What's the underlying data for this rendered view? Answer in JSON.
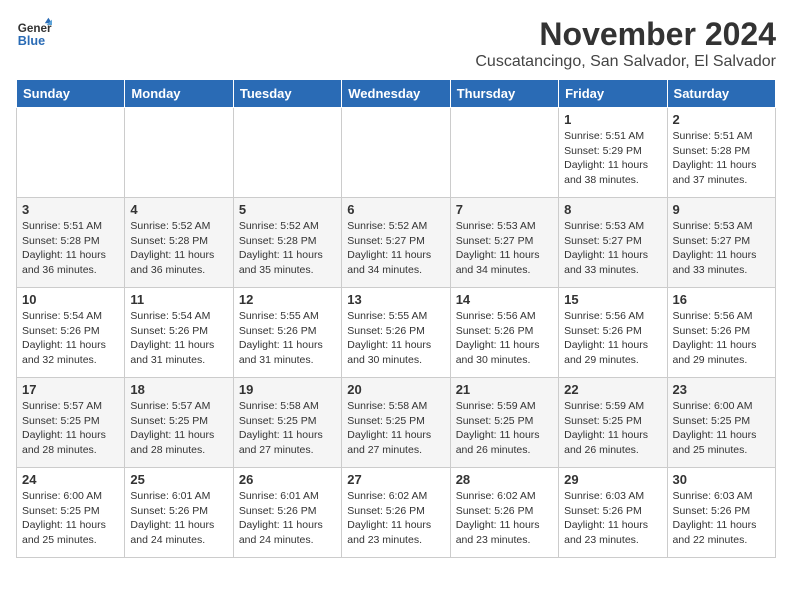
{
  "logo": {
    "line1": "General",
    "line2": "Blue"
  },
  "title": "November 2024",
  "location": "Cuscatancingo, San Salvador, El Salvador",
  "days_of_week": [
    "Sunday",
    "Monday",
    "Tuesday",
    "Wednesday",
    "Thursday",
    "Friday",
    "Saturday"
  ],
  "weeks": [
    [
      {
        "day": "",
        "content": ""
      },
      {
        "day": "",
        "content": ""
      },
      {
        "day": "",
        "content": ""
      },
      {
        "day": "",
        "content": ""
      },
      {
        "day": "",
        "content": ""
      },
      {
        "day": "1",
        "content": "Sunrise: 5:51 AM\nSunset: 5:29 PM\nDaylight: 11 hours\nand 38 minutes."
      },
      {
        "day": "2",
        "content": "Sunrise: 5:51 AM\nSunset: 5:28 PM\nDaylight: 11 hours\nand 37 minutes."
      }
    ],
    [
      {
        "day": "3",
        "content": "Sunrise: 5:51 AM\nSunset: 5:28 PM\nDaylight: 11 hours\nand 36 minutes."
      },
      {
        "day": "4",
        "content": "Sunrise: 5:52 AM\nSunset: 5:28 PM\nDaylight: 11 hours\nand 36 minutes."
      },
      {
        "day": "5",
        "content": "Sunrise: 5:52 AM\nSunset: 5:28 PM\nDaylight: 11 hours\nand 35 minutes."
      },
      {
        "day": "6",
        "content": "Sunrise: 5:52 AM\nSunset: 5:27 PM\nDaylight: 11 hours\nand 34 minutes."
      },
      {
        "day": "7",
        "content": "Sunrise: 5:53 AM\nSunset: 5:27 PM\nDaylight: 11 hours\nand 34 minutes."
      },
      {
        "day": "8",
        "content": "Sunrise: 5:53 AM\nSunset: 5:27 PM\nDaylight: 11 hours\nand 33 minutes."
      },
      {
        "day": "9",
        "content": "Sunrise: 5:53 AM\nSunset: 5:27 PM\nDaylight: 11 hours\nand 33 minutes."
      }
    ],
    [
      {
        "day": "10",
        "content": "Sunrise: 5:54 AM\nSunset: 5:26 PM\nDaylight: 11 hours\nand 32 minutes."
      },
      {
        "day": "11",
        "content": "Sunrise: 5:54 AM\nSunset: 5:26 PM\nDaylight: 11 hours\nand 31 minutes."
      },
      {
        "day": "12",
        "content": "Sunrise: 5:55 AM\nSunset: 5:26 PM\nDaylight: 11 hours\nand 31 minutes."
      },
      {
        "day": "13",
        "content": "Sunrise: 5:55 AM\nSunset: 5:26 PM\nDaylight: 11 hours\nand 30 minutes."
      },
      {
        "day": "14",
        "content": "Sunrise: 5:56 AM\nSunset: 5:26 PM\nDaylight: 11 hours\nand 30 minutes."
      },
      {
        "day": "15",
        "content": "Sunrise: 5:56 AM\nSunset: 5:26 PM\nDaylight: 11 hours\nand 29 minutes."
      },
      {
        "day": "16",
        "content": "Sunrise: 5:56 AM\nSunset: 5:26 PM\nDaylight: 11 hours\nand 29 minutes."
      }
    ],
    [
      {
        "day": "17",
        "content": "Sunrise: 5:57 AM\nSunset: 5:25 PM\nDaylight: 11 hours\nand 28 minutes."
      },
      {
        "day": "18",
        "content": "Sunrise: 5:57 AM\nSunset: 5:25 PM\nDaylight: 11 hours\nand 28 minutes."
      },
      {
        "day": "19",
        "content": "Sunrise: 5:58 AM\nSunset: 5:25 PM\nDaylight: 11 hours\nand 27 minutes."
      },
      {
        "day": "20",
        "content": "Sunrise: 5:58 AM\nSunset: 5:25 PM\nDaylight: 11 hours\nand 27 minutes."
      },
      {
        "day": "21",
        "content": "Sunrise: 5:59 AM\nSunset: 5:25 PM\nDaylight: 11 hours\nand 26 minutes."
      },
      {
        "day": "22",
        "content": "Sunrise: 5:59 AM\nSunset: 5:25 PM\nDaylight: 11 hours\nand 26 minutes."
      },
      {
        "day": "23",
        "content": "Sunrise: 6:00 AM\nSunset: 5:25 PM\nDaylight: 11 hours\nand 25 minutes."
      }
    ],
    [
      {
        "day": "24",
        "content": "Sunrise: 6:00 AM\nSunset: 5:25 PM\nDaylight: 11 hours\nand 25 minutes."
      },
      {
        "day": "25",
        "content": "Sunrise: 6:01 AM\nSunset: 5:26 PM\nDaylight: 11 hours\nand 24 minutes."
      },
      {
        "day": "26",
        "content": "Sunrise: 6:01 AM\nSunset: 5:26 PM\nDaylight: 11 hours\nand 24 minutes."
      },
      {
        "day": "27",
        "content": "Sunrise: 6:02 AM\nSunset: 5:26 PM\nDaylight: 11 hours\nand 23 minutes."
      },
      {
        "day": "28",
        "content": "Sunrise: 6:02 AM\nSunset: 5:26 PM\nDaylight: 11 hours\nand 23 minutes."
      },
      {
        "day": "29",
        "content": "Sunrise: 6:03 AM\nSunset: 5:26 PM\nDaylight: 11 hours\nand 23 minutes."
      },
      {
        "day": "30",
        "content": "Sunrise: 6:03 AM\nSunset: 5:26 PM\nDaylight: 11 hours\nand 22 minutes."
      }
    ]
  ]
}
